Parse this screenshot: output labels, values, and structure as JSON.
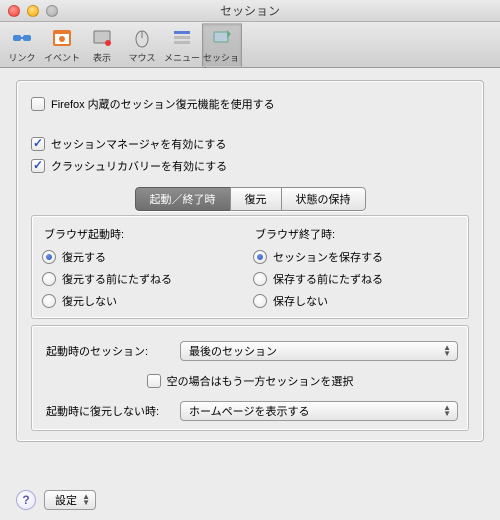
{
  "window": {
    "title": "セッション"
  },
  "toolbar": {
    "items": [
      {
        "id": "link",
        "label": "リンク"
      },
      {
        "id": "event",
        "label": "イベント"
      },
      {
        "id": "view",
        "label": "表示"
      },
      {
        "id": "mouse",
        "label": "マウス"
      },
      {
        "id": "menu",
        "label": "メニュー"
      },
      {
        "id": "session",
        "label": "セッション"
      }
    ],
    "active": "session"
  },
  "options": {
    "use_firefox_builtin": {
      "label": "Firefox 内蔵のセッション復元機能を使用する",
      "checked": false
    },
    "enable_manager": {
      "label": "セッションマネージャを有効にする",
      "checked": true
    },
    "enable_crash": {
      "label": "クラッシュリカバリーを有効にする",
      "checked": true
    }
  },
  "tabs": {
    "items": [
      "起動／終了時",
      "復元",
      "状態の保持"
    ],
    "active_index": 0
  },
  "startup_group": {
    "left_title": "ブラウザ起動時:",
    "right_title": "ブラウザ終了時:",
    "left": {
      "options": [
        "復元する",
        "復元する前にたずねる",
        "復元しない"
      ],
      "selected_index": 0
    },
    "right": {
      "options": [
        "セッションを保存する",
        "保存する前にたずねる",
        "保存しない"
      ],
      "selected_index": 0
    }
  },
  "session_row": {
    "label": "起動時のセッション:",
    "popup_value": "最後のセッション",
    "fallback_checkbox": {
      "label": "空の場合はもう一方セッションを選択",
      "checked": false
    }
  },
  "no_restore_row": {
    "label": "起動時に復元しない時:",
    "popup_value": "ホームページを表示する"
  },
  "bottom": {
    "help_glyph": "?",
    "settings_label": "設定"
  }
}
